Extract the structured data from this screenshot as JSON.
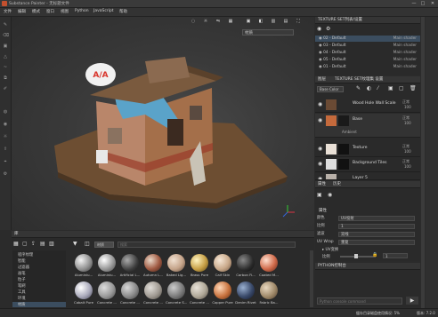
{
  "window": {
    "title": "Substance Painter - 无标题文件",
    "min": "—",
    "max": "□",
    "close": "✕"
  },
  "menu": [
    "文件",
    "编辑",
    "模式",
    "窗口",
    "视图",
    "Python",
    "JavaScript",
    "帮助"
  ],
  "viewport": {
    "mode_select": "材质",
    "logo_text": "A/A"
  },
  "texture_set_list": {
    "title": "TEXTURE SET列表/设置",
    "items": [
      {
        "name": "02 - Default",
        "shader": "Main shader"
      },
      {
        "name": "03 - Default",
        "shader": "Main shader"
      },
      {
        "name": "04 - Default",
        "shader": "Main shader"
      },
      {
        "name": "05 - Default",
        "shader": "Main shader"
      },
      {
        "name": "01 - Default",
        "shader": "Main shader"
      }
    ]
  },
  "layers": {
    "tab_layers": "图层",
    "tab_settings": "TEXTURE SET纹理集 设置",
    "channel_select": "Base Color",
    "items": [
      {
        "name": "Wood Hole Wall Scale",
        "blend": "正常",
        "opacity": "100"
      },
      {
        "name": "Base",
        "blend": "正常",
        "opacity": "100"
      },
      {
        "name": "Texture",
        "blend": "正常",
        "opacity": "100"
      },
      {
        "name": "Background Tiles",
        "blend": "正常",
        "opacity": "100"
      },
      {
        "name": "Layer 5",
        "blend": "正常",
        "opacity": "100"
      }
    ],
    "sub_item": "Ambient"
  },
  "properties": {
    "tab_properties": "属性",
    "tab_history": "历史",
    "section": "属性",
    "rows": [
      {
        "label": "颜色",
        "value": "UV投射"
      },
      {
        "label": "比例",
        "value": "1"
      },
      {
        "label": "滤波",
        "value": "双线"
      },
      {
        "label": "UV Wrap",
        "value": "重复"
      }
    ],
    "transform": "▸ UV变换",
    "scale_label": "比例",
    "scale_value": "1"
  },
  "console": {
    "title": "PYTHON控制台",
    "placeholder": "Python console command"
  },
  "shelf": {
    "title": "库",
    "search_placeholder": "搜索",
    "tab": "材质",
    "categories": [
      "程序纹理",
      "智能",
      "过滤器",
      "画笔",
      "粒子",
      "笔刷",
      "工具",
      "环境",
      "材质"
    ],
    "materials_row1": [
      "Aluminiu...",
      "Aluminiu...",
      "Artificial L...",
      "Autumn L...",
      "Baked Lig...",
      "Brass Pure",
      "Calf Skin",
      "Carbon Fi...",
      "Coated M..."
    ],
    "materials_row2": [
      "Cobalt Pure",
      "Concrete ...",
      "Concrete ...",
      "Concrete ...",
      "Concrete S...",
      "Concrete ...",
      "Copper Pure",
      "Denim Rivet",
      "Fabric Ba..."
    ]
  },
  "statusbar": {
    "text": "缓存目录磁盘使用情况: 5%",
    "version": "版本: 7.2.0"
  }
}
